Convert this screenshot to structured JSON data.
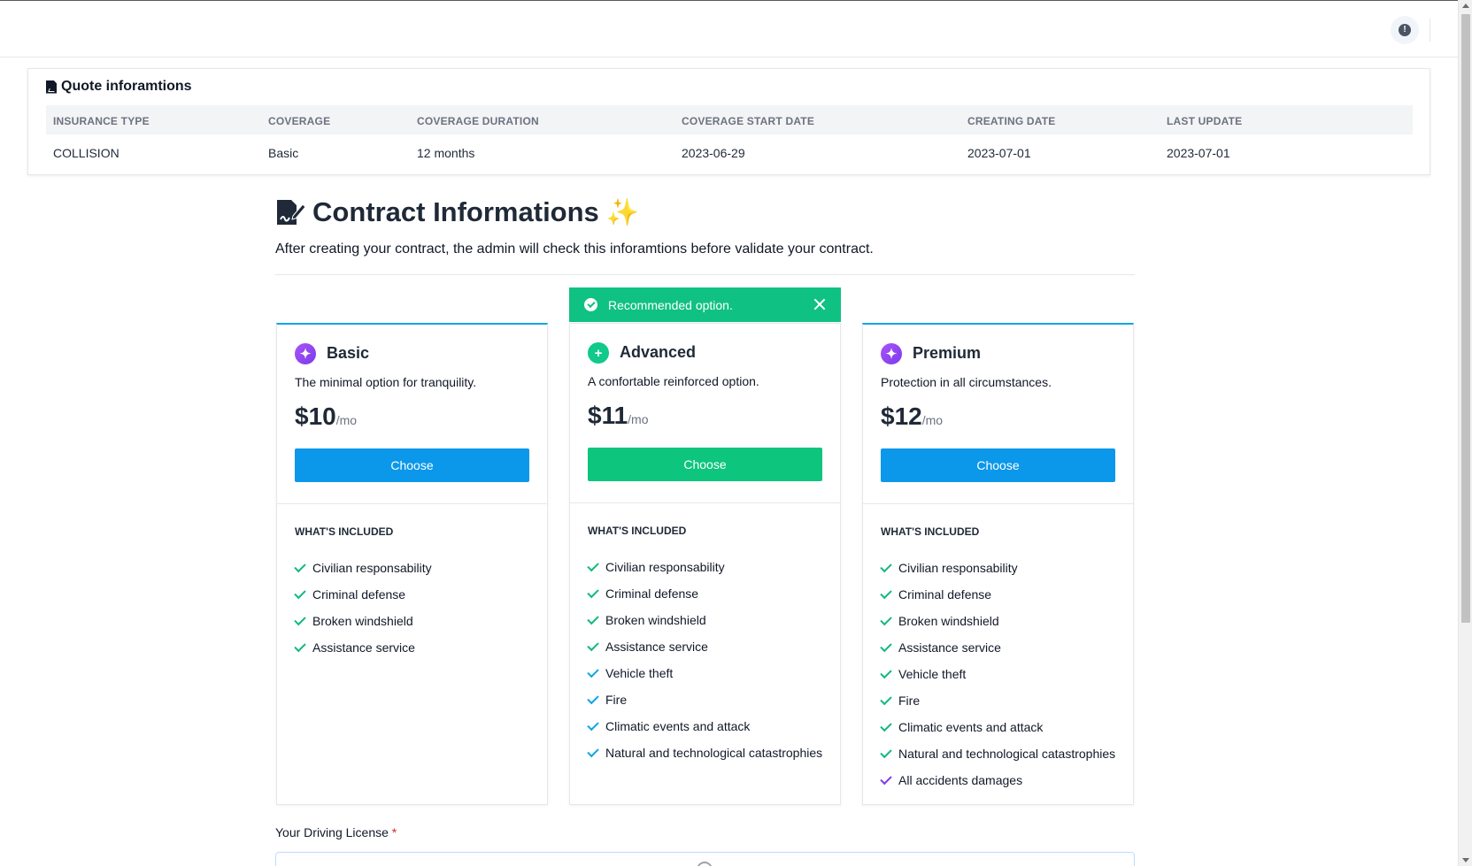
{
  "quote": {
    "title": "Quote inforamtions",
    "headers": [
      "INSURANCE TYPE",
      "COVERAGE",
      "COVERAGE DURATION",
      "COVERAGE START DATE",
      "CREATING DATE",
      "LAST UPDATE"
    ],
    "values": [
      "COLLISION",
      "Basic",
      "12 months",
      "2023-06-29",
      "2023-07-01",
      "2023-07-01"
    ]
  },
  "contract": {
    "title": "Contract Informations",
    "subtitle": "After creating your contract, the admin will check this inforamtions before validate your contract."
  },
  "recommendation": {
    "text": "Recommended option."
  },
  "included_label": "WHAT'S INCLUDED",
  "plans": [
    {
      "name": "Basic",
      "description": "The minimal option for tranquility.",
      "price": "$10",
      "period": "/mo",
      "button": "Choose",
      "features": [
        "Civilian responsability",
        "Criminal defense",
        "Broken windshield",
        "Assistance service"
      ]
    },
    {
      "name": "Advanced",
      "description": "A confortable reinforced option.",
      "price": "$11",
      "period": "/mo",
      "button": "Choose",
      "features": [
        "Civilian responsability",
        "Criminal defense",
        "Broken windshield",
        "Assistance service",
        "Vehicle theft",
        "Fire",
        "Climatic events and attack",
        "Natural and technological catastrophies"
      ]
    },
    {
      "name": "Premium",
      "description": "Protection in all circumstances.",
      "price": "$12",
      "period": "/mo",
      "button": "Choose",
      "features": [
        "Civilian responsability",
        "Criminal defense",
        "Broken windshield",
        "Assistance service",
        "Vehicle theft",
        "Fire",
        "Climatic events and attack",
        "Natural and technological catastrophies",
        "All accidents damages"
      ]
    }
  ],
  "license": {
    "label": "Your Driving License",
    "required_mark": "*"
  },
  "colors": {
    "blue": "#0b98ea",
    "green": "#0ec57e",
    "purple": "#7c3aed"
  }
}
